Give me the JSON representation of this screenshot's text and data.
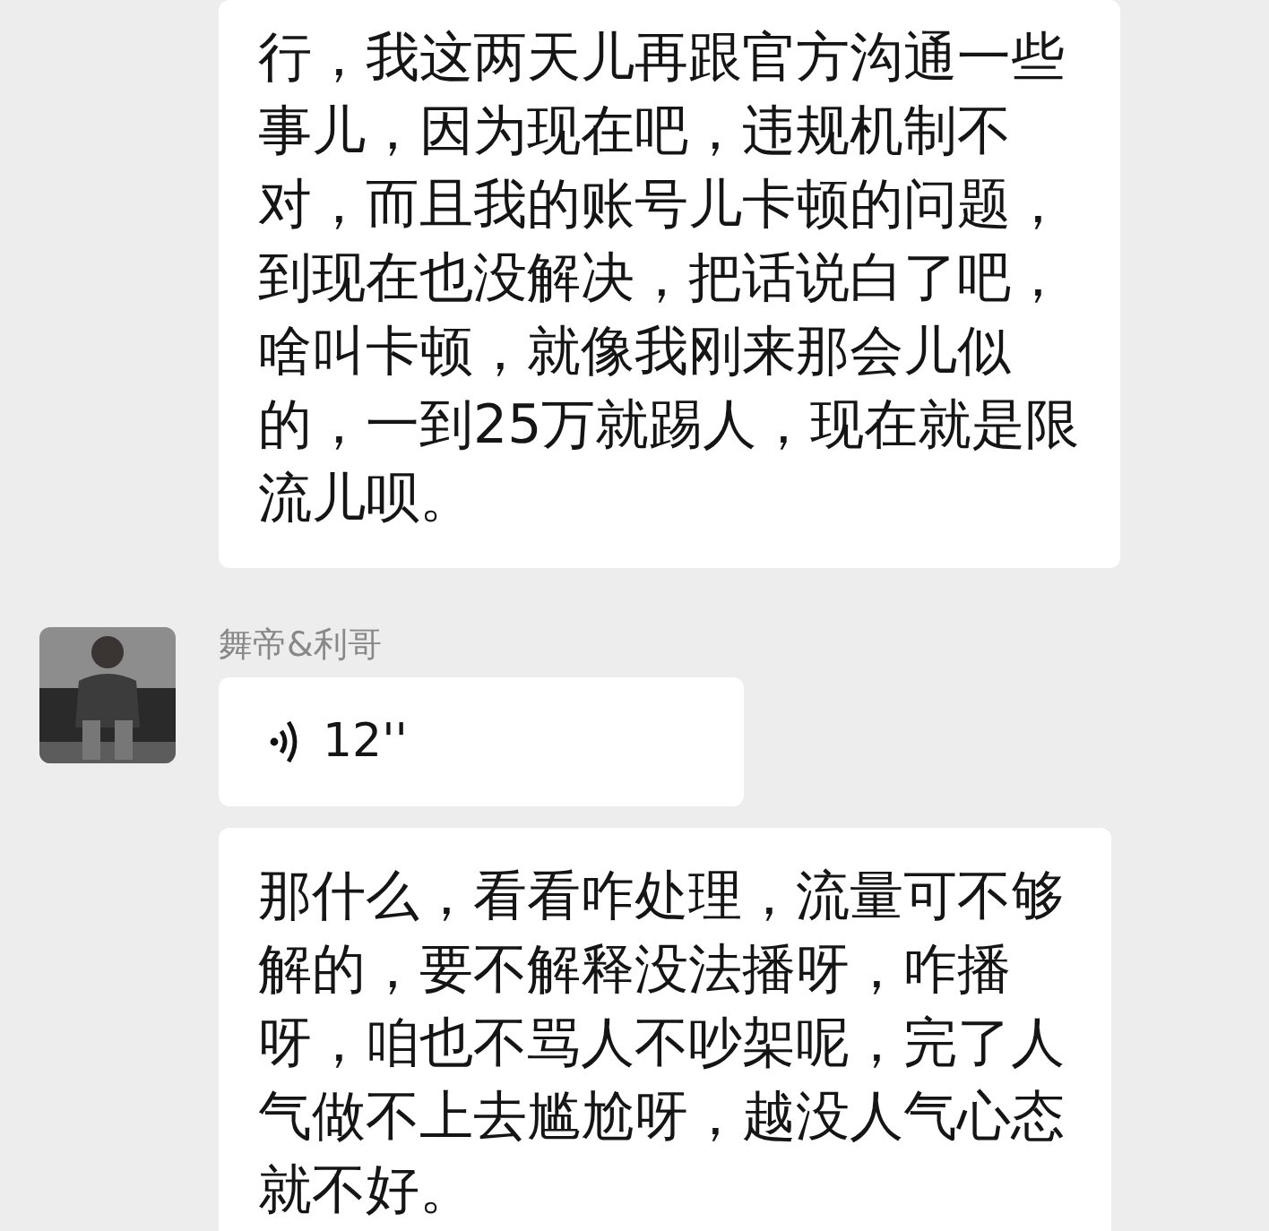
{
  "messages": [
    {
      "kind": "text",
      "text": "行，我这两天儿再跟官方沟通一些事儿，因为现在吧，违规机制不对，而且我的账号儿卡顿的问题，到现在也没解决，把话说白了吧，啥叫卡顿，就像我刚来那会儿似的，一到25万就踢人，现在就是限流儿呗。"
    },
    {
      "kind": "voice",
      "sender": "舞帝&利哥",
      "duration": "12''"
    },
    {
      "kind": "text",
      "text": "那什么，看看咋处理，流量可不够解的，要不解释没法播呀，咋播呀，咱也不骂人不吵架呢，完了人气做不上去尴尬呀，越没人气心态就不好。"
    }
  ]
}
